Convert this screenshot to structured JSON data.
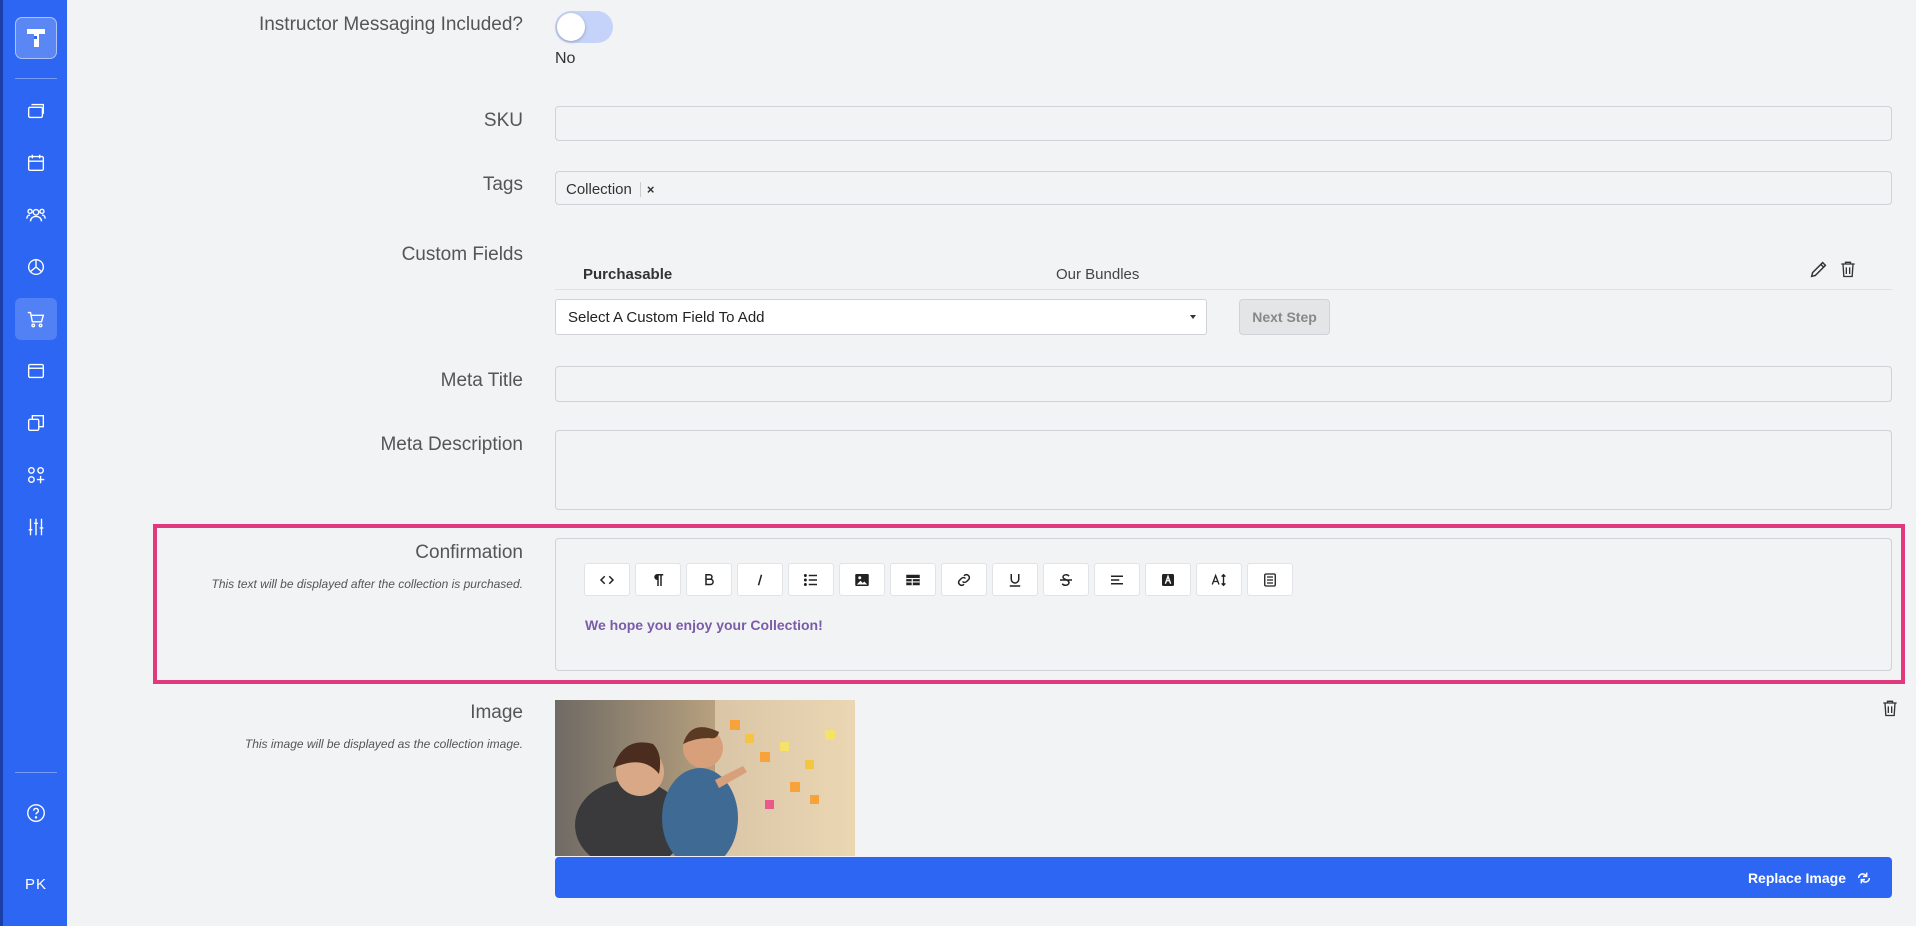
{
  "sidebar": {
    "items": [
      {
        "name": "courses",
        "icon": "layers-icon"
      },
      {
        "name": "calendar",
        "icon": "calendar-icon"
      },
      {
        "name": "users",
        "icon": "users-icon"
      },
      {
        "name": "reports",
        "icon": "pie-chart-icon"
      },
      {
        "name": "store",
        "icon": "cart-icon",
        "active": true
      },
      {
        "name": "pages",
        "icon": "browser-window-icon"
      },
      {
        "name": "collections",
        "icon": "copy-icon"
      },
      {
        "name": "apps",
        "icon": "apps-add-icon"
      },
      {
        "name": "settings",
        "icon": "sliders-icon"
      }
    ],
    "help_icon": "help-circle-icon",
    "user_initials": "PK"
  },
  "form": {
    "instructor_messaging": {
      "label": "Instructor Messaging Included?",
      "value": "No"
    },
    "sku": {
      "label": "SKU",
      "value": ""
    },
    "tags": {
      "label": "Tags",
      "items": [
        {
          "label": "Collection",
          "remove": "×"
        }
      ]
    },
    "custom_fields": {
      "label": "Custom Fields",
      "rows": [
        {
          "name": "Purchasable",
          "value": "Our Bundles"
        }
      ],
      "select_placeholder": "Select A Custom Field To Add",
      "next_label": "Next Step"
    },
    "meta_title": {
      "label": "Meta Title",
      "value": ""
    },
    "meta_description": {
      "label": "Meta Description",
      "value": ""
    },
    "confirmation": {
      "label": "Confirmation",
      "help": "This text will be displayed after the collection is purchased.",
      "content": "We hope you enjoy your Collection!",
      "toolbar": [
        {
          "name": "code-view",
          "icon": "code-icon"
        },
        {
          "name": "paragraph",
          "icon": "paragraph-icon"
        },
        {
          "name": "bold",
          "icon": "bold-icon"
        },
        {
          "name": "italic",
          "icon": "italic-icon"
        },
        {
          "name": "bullet-list",
          "icon": "list-icon"
        },
        {
          "name": "insert-image",
          "icon": "image-icon"
        },
        {
          "name": "insert-table",
          "icon": "table-icon"
        },
        {
          "name": "insert-link",
          "icon": "link-icon"
        },
        {
          "name": "underline",
          "icon": "underline-icon"
        },
        {
          "name": "strikethrough",
          "icon": "strikethrough-icon"
        },
        {
          "name": "align",
          "icon": "align-left-icon"
        },
        {
          "name": "text-color",
          "icon": "text-color-icon"
        },
        {
          "name": "font-size",
          "icon": "font-size-icon"
        },
        {
          "name": "format-block",
          "icon": "document-icon"
        }
      ]
    },
    "image": {
      "label": "Image",
      "help": "This image will be displayed as the collection image.",
      "replace_label": "Replace Image"
    }
  },
  "colors": {
    "sidebar": "#2d66f3",
    "highlight": "#e2387d",
    "accent": "#2d66f3",
    "editor_text": "#7a5ca8"
  }
}
